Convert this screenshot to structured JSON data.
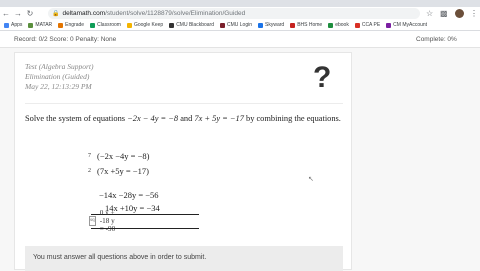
{
  "browser": {
    "url_host": "deltamath.com",
    "url_path": "/student/solve/1128879/solve/Elimination/Guided",
    "bookmarks": [
      "Apps",
      "MATAR",
      "Engrade",
      "Classroom",
      "Google Keep",
      "CMU Blackboard",
      "CMU Login",
      "Skyward",
      "BHS Home",
      "ebook",
      "CCA PE",
      "CM MyAccount"
    ]
  },
  "status": {
    "left": "Record: 0/2   Score: 0   Penalty: None",
    "right": "Complete: 0%"
  },
  "assignment": {
    "line1": "Test (Algebra Support)",
    "line2": "Elimination (Guided)",
    "line3": "May 22, 12:13:29 PM",
    "help_symbol": "?"
  },
  "problem": {
    "prefix": "Solve the system of equations",
    "eq1": "−2x − 4y = −8",
    "mid": "and",
    "eq2": "7x + 5y = −17",
    "suffix": "by combining the equations."
  },
  "work": {
    "mult1": "7",
    "mult2": "2",
    "row1": "(−2x    −4y    = −8)",
    "row2": "(7x      +5y    = −17)",
    "row3": "−14x   −28y    = −56",
    "row4": "14x   +10y    = −34",
    "answer_box": "sq",
    "answer": "0  x +  -18  y =  -90"
  },
  "footer": {
    "message": "You must answer all questions above in order to submit."
  },
  "colors": {
    "card": "#ffffff",
    "page": "#f7f7f7",
    "footer": "#ececec"
  }
}
